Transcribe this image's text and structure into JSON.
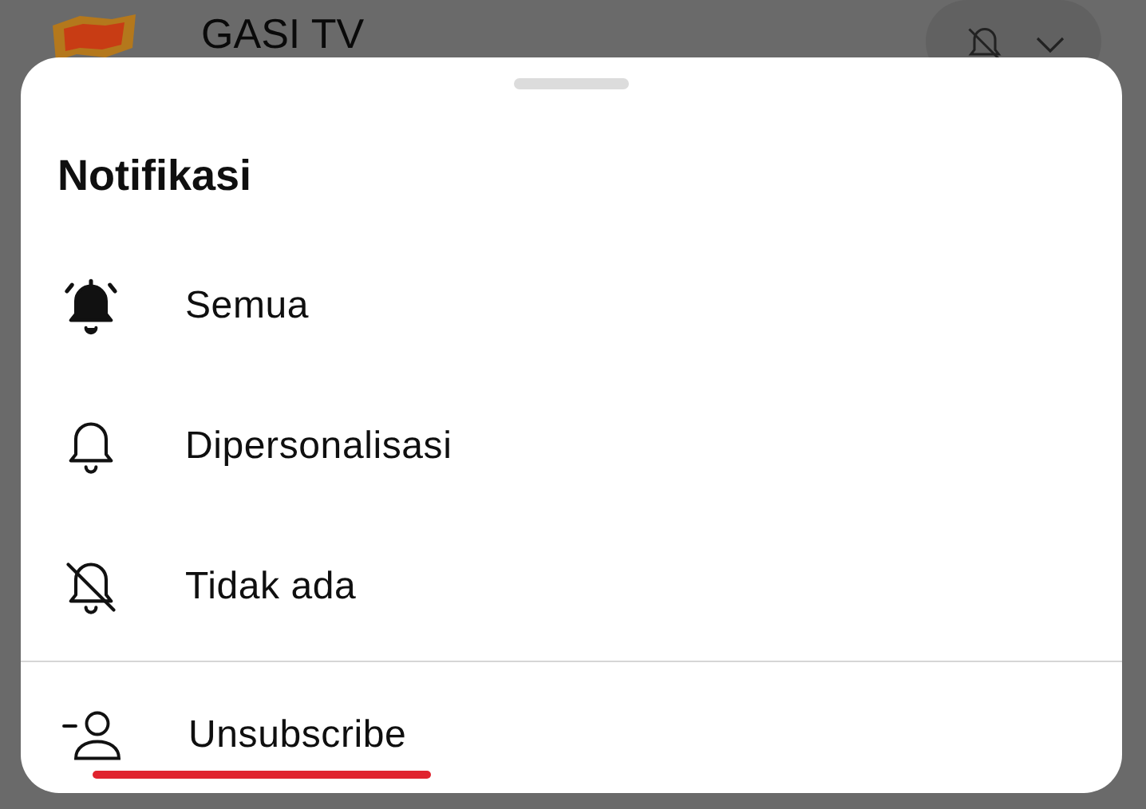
{
  "channel": {
    "name": "GASI TV"
  },
  "sheet": {
    "title": "Notifikasi",
    "options": [
      {
        "kind": "all",
        "label": "Semua"
      },
      {
        "kind": "personalized",
        "label": "Dipersonalisasi"
      },
      {
        "kind": "none",
        "label": "Tidak ada"
      }
    ],
    "unsubscribe": {
      "label": "Unsubscribe",
      "highlighted": true
    }
  }
}
